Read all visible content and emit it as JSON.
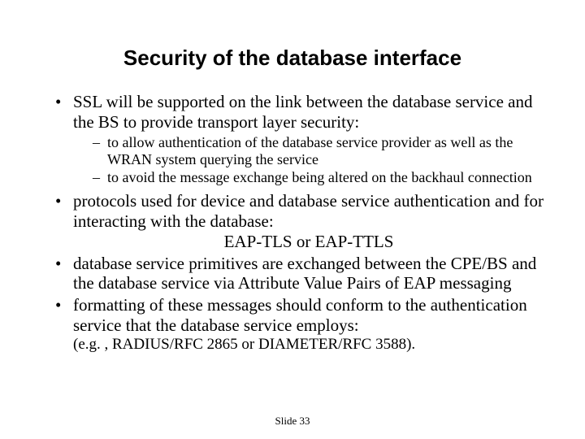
{
  "title": "Security of the database interface",
  "bullets": {
    "b1": "SSL will be supported on the link between the database service and the BS to provide transport layer security:",
    "b1_subs": {
      "s1": "to allow authentication of the database service provider as well as the WRAN system querying the service",
      "s2": "to avoid the message exchange being altered on the backhaul connection"
    },
    "b2_line1": "protocols used for device and database service authentication and for interacting with the database:",
    "b2_line2": "EAP-TLS or EAP-TTLS",
    "b3": "database service primitives are exchanged between the CPE/BS and the database service via Attribute Value Pairs of EAP messaging",
    "b4": "formatting of these messages should conform to the authentication service that the database service employs:",
    "b4_trail": "(e.g. , RADIUS/RFC 2865 or DIAMETER/RFC 3588)."
  },
  "footer": "Slide 33"
}
